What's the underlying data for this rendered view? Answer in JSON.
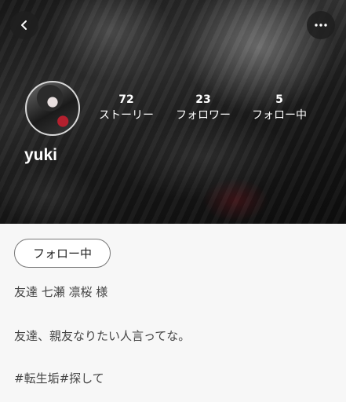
{
  "profile": {
    "username": "yuki",
    "stats": {
      "stories_count": "72",
      "stories_label": "ストーリー",
      "followers_count": "23",
      "followers_label": "フォロワー",
      "following_count": "5",
      "following_label": "フォロー中"
    },
    "follow_button_label": "フォロー中",
    "bio_lines": [
      "友達 七瀬 凛桜 様",
      "友達、親友なりたい人言ってな。",
      "#転生垢#探して"
    ]
  },
  "icons": {
    "back": "chevron-left-icon",
    "more": "more-horizontal-icon"
  }
}
